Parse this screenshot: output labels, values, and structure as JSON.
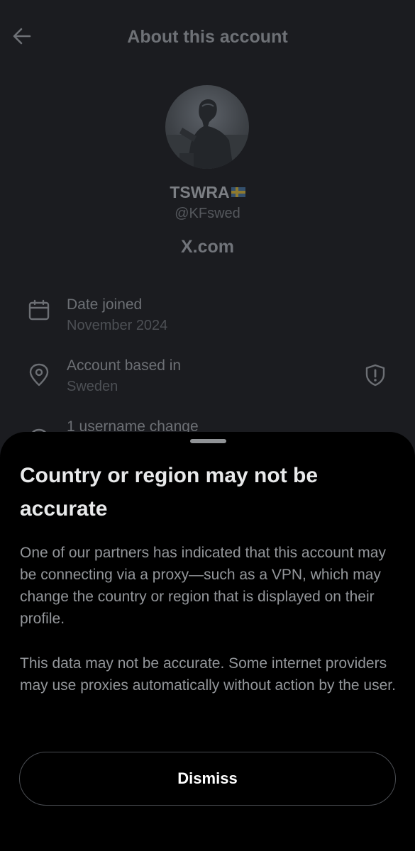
{
  "header": {
    "title": "About this account",
    "back_icon": "arrow-left-icon"
  },
  "profile": {
    "display_name": "TSWRA",
    "flag_icon": "sweden-flag-icon",
    "handle": "@KFswed",
    "domain": "X.com"
  },
  "details": [
    {
      "icon": "calendar-icon",
      "label": "Date joined",
      "value": "November 2024"
    },
    {
      "icon": "location-pin-icon",
      "label": "Account based in",
      "value": "Sweden",
      "badge_icon": "shield-alert-icon"
    },
    {
      "icon": "username-change-icon",
      "label": "1 username change"
    }
  ],
  "sheet": {
    "title": "Country or region may not be accurate",
    "paragraph_1": "One of our partners has indicated that this account may be connecting via a proxy—such as a VPN, which may change the country or region that is displayed on their profile.",
    "paragraph_2": "This data may not be accurate. Some internet providers may use proxies automatically without action by the user.",
    "dismiss_label": "Dismiss"
  },
  "colors": {
    "background": "#1b1c20",
    "sheet_background": "#000000",
    "sheet_title": "#e8e9ea",
    "sheet_body": "#93969a",
    "button_border": "#4a4d52"
  }
}
